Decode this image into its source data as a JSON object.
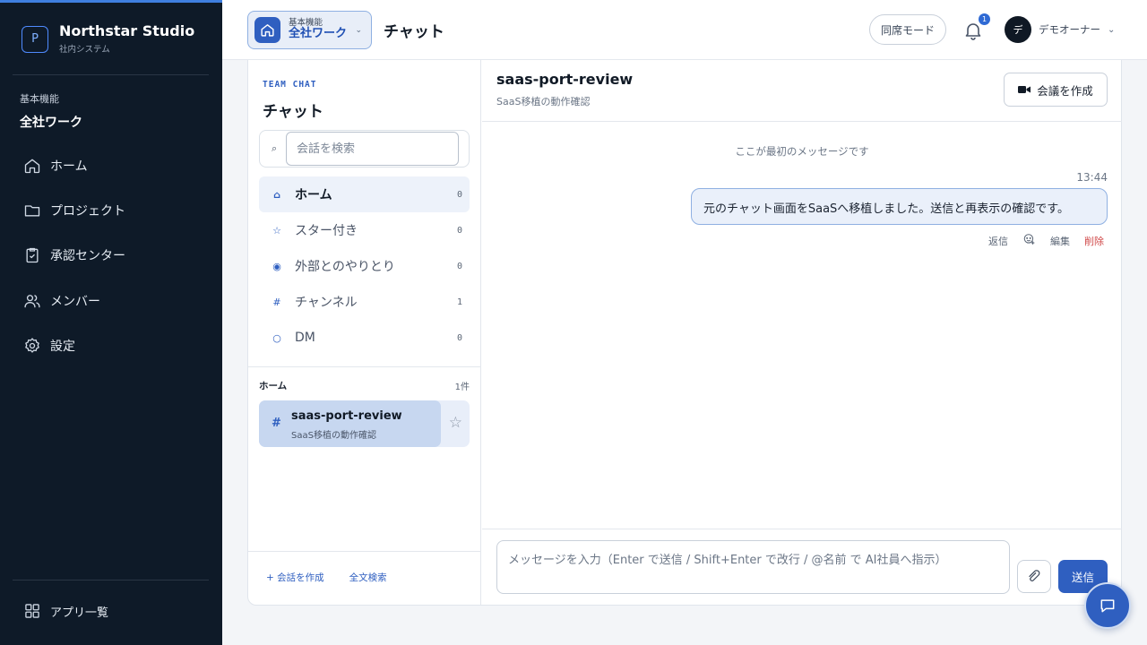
{
  "brand": {
    "logo_letter": "P",
    "name": "Northstar Studio",
    "subtitle": "社内システム"
  },
  "sidebar": {
    "section_label": "基本機能",
    "section_title": "全社ワーク",
    "items": [
      {
        "label": "ホーム",
        "icon": "home-icon"
      },
      {
        "label": "プロジェクト",
        "icon": "folder-icon"
      },
      {
        "label": "承認センター",
        "icon": "clipboard-check-icon"
      },
      {
        "label": "メンバー",
        "icon": "users-icon"
      },
      {
        "label": "設定",
        "icon": "gear-icon"
      }
    ],
    "apps_label": "アプリ一覧"
  },
  "header": {
    "workspace_label": "基本機能",
    "workspace_value": "全社ワーク",
    "title": "チャット",
    "meeting_mode": "同席モード",
    "notification_count": "1",
    "user_initial": "デ",
    "user_name": "デモオーナー"
  },
  "chat_list": {
    "eyebrow": "TEAM CHAT",
    "title": "チャット",
    "search_placeholder": "会話を検索",
    "filters": [
      {
        "icon": "⌂",
        "label": "ホーム",
        "count": "0",
        "active": true
      },
      {
        "icon": "☆",
        "label": "スター付き",
        "count": "0"
      },
      {
        "icon": "◉",
        "label": "外部とのやりとり",
        "count": "0"
      },
      {
        "icon": "#",
        "label": "チャンネル",
        "count": "1"
      },
      {
        "icon": "○",
        "label": "DM",
        "count": "0"
      }
    ],
    "group_title": "ホーム",
    "group_count": "1件",
    "conversations": [
      {
        "hash": "#",
        "name": "saas-port-review",
        "subtitle": "SaaS移植の動作確認"
      }
    ],
    "footer_create": "+ 会話を作成",
    "footer_search": "全文検索"
  },
  "chat": {
    "title": "saas-port-review",
    "subtitle": "SaaS移植の動作確認",
    "create_meeting": "会議を作成",
    "first_message_note": "ここが最初のメッセージです",
    "messages": [
      {
        "time": "13:44",
        "text": "元のチャット画面をSaaSへ移植しました。送信と再表示の確認です。"
      }
    ],
    "actions": {
      "reply": "返信",
      "edit": "編集",
      "delete": "削除"
    },
    "composer_placeholder": "メッセージを入力（Enter で送信 / Shift+Enter で改行 / @名前 で AI社員へ指示）",
    "send_label": "送信"
  },
  "colors": {
    "sidebar_bg": "#0e1a28",
    "accent": "#2f5fc0",
    "danger": "#d04848"
  }
}
